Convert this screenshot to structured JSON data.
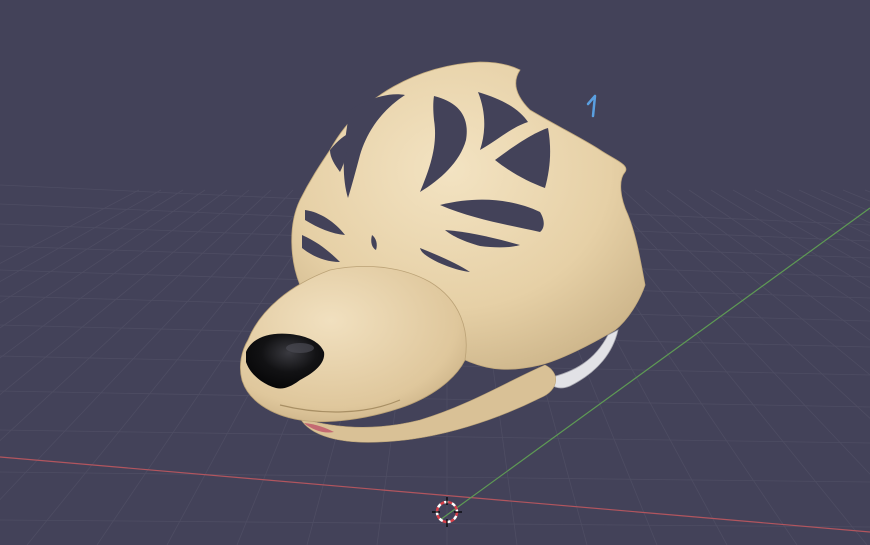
{
  "viewport": {
    "mode": "3d-viewport",
    "background_color": "#434259",
    "grid_line_color": "#4e4d63",
    "grid_visible": true
  },
  "axes": {
    "x_axis_color": "#b2555e",
    "y_axis_color": "#5e9a54"
  },
  "scene_object": {
    "description_icon": "wolf-head-mask-icon",
    "base_color": "#ead7b0",
    "shadow_color": "#c8b186",
    "nose_color": "#0e0e10",
    "strap_color": "#e2e2e6",
    "tongue_color": "#c46a72"
  },
  "cursor_3d": {
    "icon": "3d-cursor-icon",
    "ring_color_a": "#d8404a",
    "ring_color_b": "#ffffff"
  },
  "light_gizmo": {
    "icon": "light-direction-icon",
    "color": "#5a9fe0"
  }
}
